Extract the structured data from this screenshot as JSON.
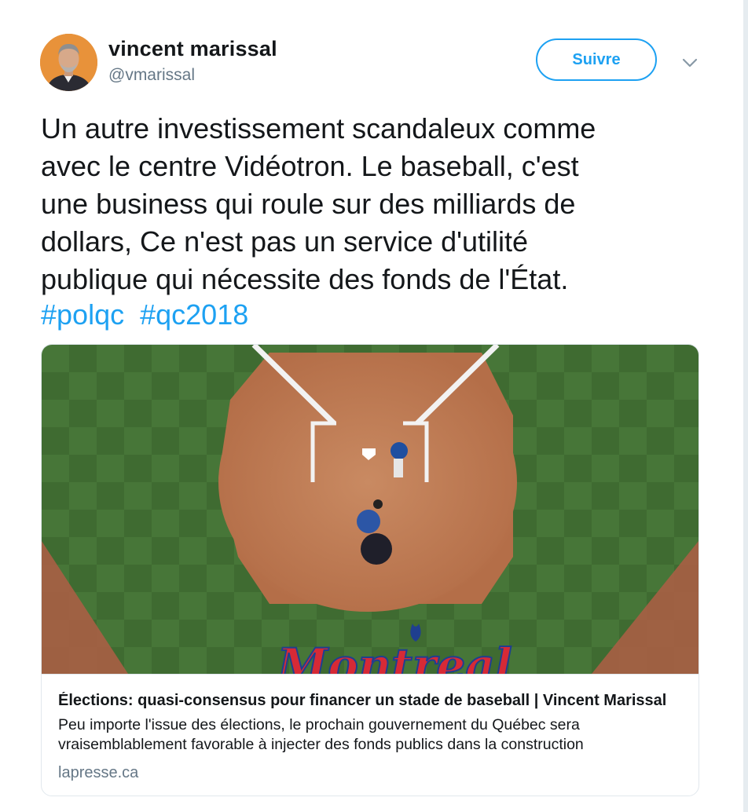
{
  "user": {
    "display_name": "vincent marissal",
    "handle": "@vmarissal"
  },
  "follow_button": {
    "label": "Suivre"
  },
  "menu": {
    "icon": "chevron-down-icon"
  },
  "tweet": {
    "lines": [
      "Un autre investissement scandaleux comme",
      "avec le centre Vidéotron. Le baseball, c'est",
      "une business qui roule sur des milliards de",
      "dollars, Ce n'est pas un service d'utilité",
      "publique qui nécessite des fonds de l'État."
    ],
    "hashtags": [
      "#polqc",
      "#qc2018"
    ]
  },
  "card": {
    "image_logo_text": "Montreal",
    "title": "Élections: quasi-consensus pour financer un stade de baseball | Vincent Marissal",
    "description_lines": [
      "Peu importe l'issue des élections, le prochain gouvernement du Québec sera",
      "vraisemblablement favorable à injecter des fonds publics dans la construction"
    ],
    "domain": "lapresse.ca"
  },
  "colors": {
    "accent": "#1da1f2",
    "text": "#14171a",
    "muted": "#657786",
    "border": "#e1e8ed"
  }
}
